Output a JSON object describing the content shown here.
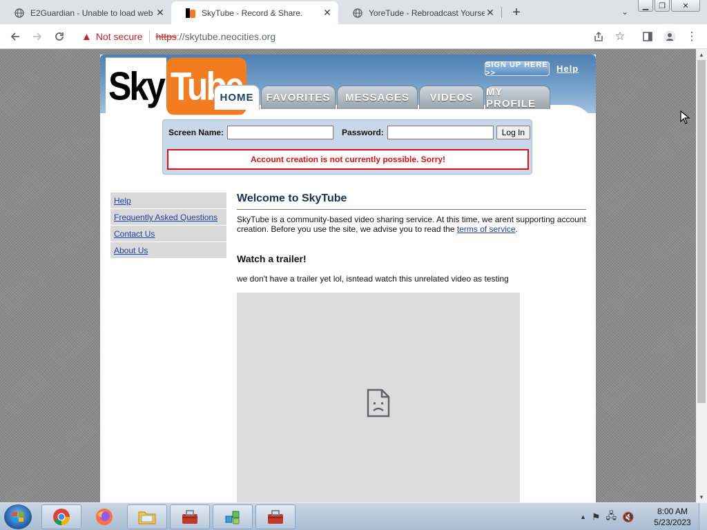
{
  "browser": {
    "tabs": [
      {
        "title": "E2Guardian - Unable to load web",
        "icon": "globe-icon",
        "active": false
      },
      {
        "title": "SkyTube - Record & Share.",
        "icon": "skytube-favicon",
        "active": true
      },
      {
        "title": "YoreTude - Rebroadcast Yourself.",
        "icon": "globe-icon",
        "active": false
      }
    ],
    "security_label": "Not secure",
    "url_protocol": "https",
    "url_rest": "://skytube.neocities.org"
  },
  "site": {
    "logo": {
      "sky": "Sky",
      "tube": "Tube"
    },
    "signup_label": "SIGN UP HERE >>",
    "help_label": "Help",
    "nav": [
      "HOME",
      "FAVORITES",
      "MESSAGES",
      "VIDEOS",
      "MY PROFILE"
    ],
    "login": {
      "screen_name_label": "Screen Name:",
      "password_label": "Password:",
      "login_button": "Log In",
      "error": "Account creation is not currently possible. Sorry!"
    },
    "sidebar": [
      "Help",
      "Frequently Asked Questions",
      "Contact Us",
      "About Us"
    ],
    "main": {
      "title": "Welcome to SkyTube",
      "intro_text": "SkyTube is a community-based video sharing service. At this time, we arent supporting account creation. Before you use the site, we advise you to read the ",
      "tos_link": "terms of service",
      "intro_end": ".",
      "trailer_heading": "Watch a trailer!",
      "trailer_text": "we don't have a trailer yet lol, isntead watch this unrelated video as testing"
    }
  },
  "taskbar": {
    "time": "8:00 AM",
    "date": "5/23/2023"
  }
}
